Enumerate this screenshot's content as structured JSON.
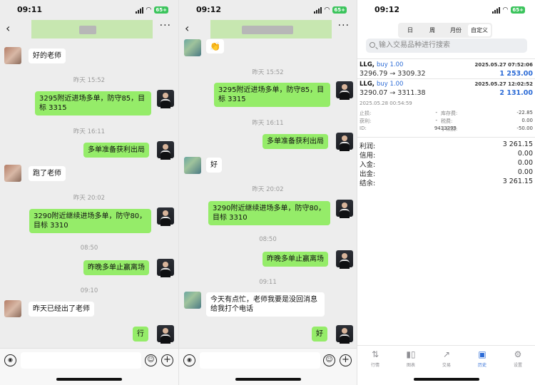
{
  "left": {
    "status_time": "09:11",
    "battery": "65+",
    "ts": [
      "昨天 15:52",
      "昨天 16:11",
      "昨天 20:02",
      "08:50",
      "09:10"
    ],
    "msgs": [
      "好的老师",
      "3295附近进场多单，防守85，目标 3315",
      "多单准备获利出局",
      "跑了老师",
      "3290附近继续进场多单，防守80，目标 3310",
      "昨晚多单止赢离场",
      "昨天已经出了老师",
      "行"
    ]
  },
  "middle": {
    "status_time": "09:12",
    "battery": "65+",
    "ts": [
      "昨天 15:52",
      "昨天 16:11",
      "昨天 20:02",
      "08:50",
      "09:11"
    ],
    "msgs": [
      "👏",
      "3295附近进场多单，防守85，目标 3315",
      "多单准备获利出局",
      "好",
      "3290附近继续进场多单，防守80，目标 3310",
      "昨晚多单止赢离场",
      "今天有点忙，老师我要是没回消息给我打个电话",
      "好"
    ]
  },
  "right": {
    "status_time": "09:12",
    "battery": "65+",
    "segments": [
      "日",
      "周",
      "月份",
      "自定义"
    ],
    "search_placeholder": "输入交易品种进行搜索",
    "trades": [
      {
        "symbol": "LLG,",
        "side": "buy 1.00",
        "date": "2025.05.27 07:52:06",
        "price": "3296.79 → 3309.32",
        "pnl": "1 253.00"
      },
      {
        "symbol": "LLG,",
        "side": "buy 1.00",
        "date": "2025.05.27 12:02:52",
        "price": "3290.07 → 3311.38",
        "pnl": "2 131.00"
      }
    ],
    "detail": {
      "close_time": "2025.05.28 00:54:59",
      "labels": [
        "止损:",
        "获利:",
        "ID:",
        "库存费:",
        "税费:",
        "手续费:"
      ],
      "values": [
        "-",
        "-",
        "9413293",
        "-22.85",
        "0.00",
        "-50.00"
      ]
    },
    "summary": [
      {
        "label": "利润:",
        "value": "3 261.15"
      },
      {
        "label": "信用:",
        "value": "0.00"
      },
      {
        "label": "入金:",
        "value": "0.00"
      },
      {
        "label": "出金:",
        "value": "0.00"
      },
      {
        "label": "结余:",
        "value": "3 261.15"
      }
    ],
    "tabs": [
      {
        "label": "行情",
        "icon": "quotes-icon"
      },
      {
        "label": "图表",
        "icon": "chart-icon"
      },
      {
        "label": "交易",
        "icon": "trade-icon"
      },
      {
        "label": "历史",
        "icon": "history-icon"
      },
      {
        "label": "设置",
        "icon": "settings-icon"
      }
    ],
    "accent": "#2c6bd6"
  },
  "colors": {
    "bubble_me": "#95ec69",
    "chat_bg": "#ededed"
  }
}
